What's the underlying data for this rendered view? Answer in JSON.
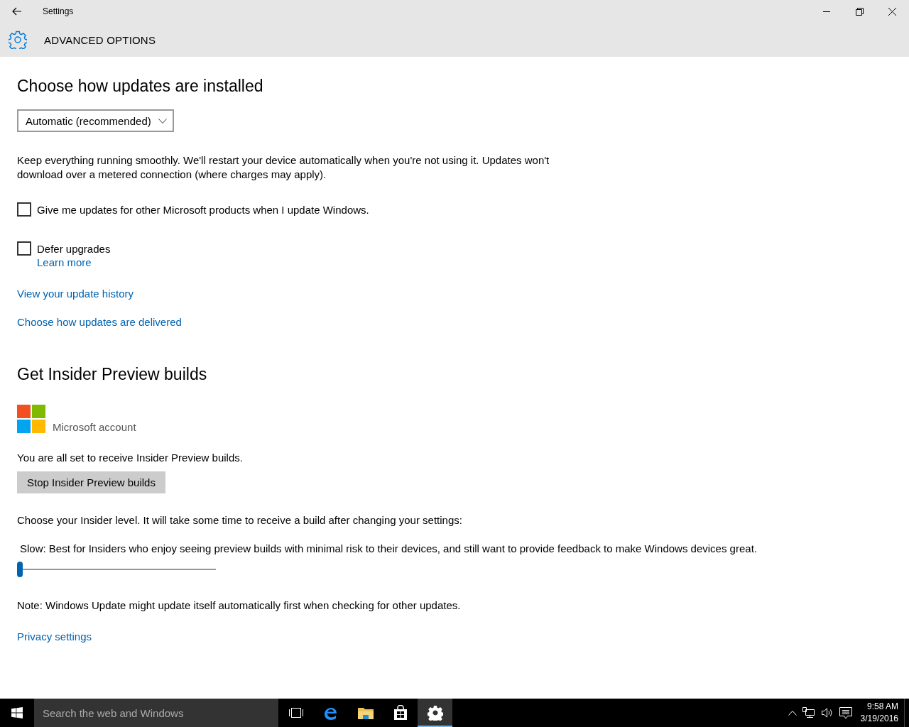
{
  "window": {
    "title": "Settings",
    "page_title": "ADVANCED OPTIONS"
  },
  "install_section": {
    "heading": "Choose how updates are installed",
    "dropdown": {
      "value": "Automatic (recommended)"
    },
    "description": "Keep everything running smoothly. We'll restart your device automatically when you're not using it. Updates won't download over a metered connection (where charges may apply)."
  },
  "options": [
    {
      "label": "Give me updates for other Microsoft products when I update Windows.",
      "checked": false
    },
    {
      "label": "Defer upgrades",
      "checked": false,
      "link": "Learn more"
    }
  ],
  "links": [
    "View your update history",
    "Choose how updates are delivered"
  ],
  "insider_section": {
    "heading": "Get Insider Preview builds",
    "account": "Microsoft account",
    "status": "You are all set to receive Insider Preview builds.",
    "button": "Stop Insider Preview builds",
    "level_prompt": "Choose your Insider level. It will take some time to receive a build after changing your settings:",
    "level_description": "Slow: Best for Insiders who enjoy seeing preview builds with minimal risk to their devices, and still want to provide feedback to make Windows devices great.",
    "slider": {
      "level": 0
    }
  },
  "note": "Note: Windows Update might update itself automatically first when checking for other updates.",
  "privacy_link": "Privacy settings",
  "taskbar": {
    "search": {
      "placeholder": "Search the web and Windows"
    },
    "apps": [
      {
        "kind": "taskview",
        "selected": false
      },
      {
        "kind": "browser",
        "selected": false
      },
      {
        "kind": "folder",
        "selected": false
      },
      {
        "kind": "store",
        "selected": false
      },
      {
        "kind": "settings",
        "selected": true
      }
    ],
    "time": "9:58 AM",
    "date": "3/19/2016"
  }
}
